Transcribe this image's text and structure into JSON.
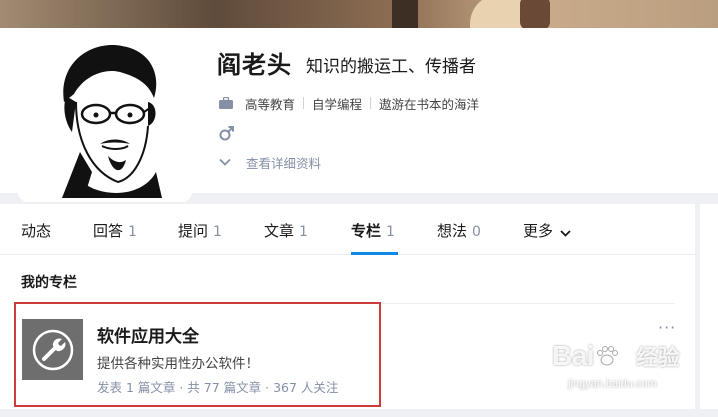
{
  "profile": {
    "name": "阎老头",
    "headline": "知识的搬运工、传播者",
    "industry": "高等教育",
    "major": "自学编程",
    "school": "遨游在书本的海洋",
    "detail_link": "查看详细资料",
    "icons": {
      "industry": "briefcase-icon",
      "gender": "male-icon",
      "expand": "chevron-down-icon"
    }
  },
  "tabs": [
    {
      "label": "动态",
      "count": ""
    },
    {
      "label": "回答",
      "count": "1"
    },
    {
      "label": "提问",
      "count": "1"
    },
    {
      "label": "文章",
      "count": "1"
    },
    {
      "label": "专栏",
      "count": "1",
      "active": true
    },
    {
      "label": "想法",
      "count": "0"
    },
    {
      "label": "更多",
      "count": ""
    }
  ],
  "section": {
    "title": "我的专栏"
  },
  "column": {
    "title": "软件应用大全",
    "description": "提供各种实用性办公软件！",
    "meta": "发表 1 篇文章 · 共 77 篇文章 · 367 人关注",
    "more_label": "···",
    "icon": "wrench-icon"
  },
  "colors": {
    "accent": "#0f88eb",
    "highlight_border": "#cf3b3b",
    "muted_text": "#8590a6"
  },
  "watermark": {
    "brand": "Bai",
    "brand_cn": "经验",
    "url": "jingyan.baidu.com"
  }
}
